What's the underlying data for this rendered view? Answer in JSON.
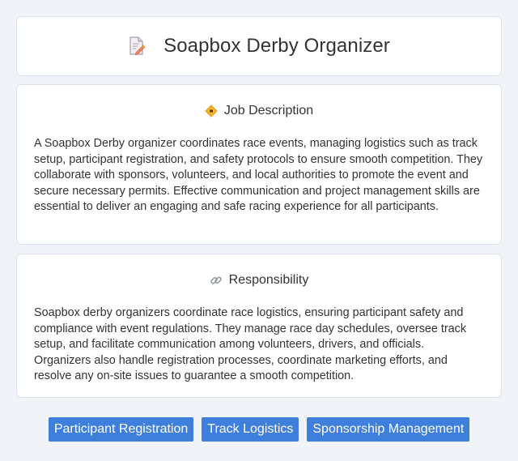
{
  "header": {
    "title": "Soapbox Derby Organizer",
    "icon": "document-edit-icon"
  },
  "job_description": {
    "title": "Job Description",
    "icon": "diamond-sign-icon",
    "text": "A Soapbox Derby organizer coordinates race events, managing logistics such as track setup, participant registration, and safety protocols to ensure smooth competition. They collaborate with sponsors, volunteers, and local authorities to promote the event and secure necessary permits. Effective communication and project management skills are essential to deliver an engaging and safe racing experience for all participants."
  },
  "responsibility": {
    "title": "Responsibility",
    "icon": "link-icon",
    "text": "Soapbox derby organizers coordinate race logistics, ensuring participant safety and compliance with event regulations. They manage race day schedules, oversee track setup, and facilitate communication among volunteers, drivers, and officials. Organizers also handle registration processes, coordinate marketing efforts, and resolve any on-site issues to guarantee a smooth competition."
  },
  "tags": [
    "Participant Registration",
    "Track Logistics",
    "Sponsorship Management"
  ],
  "colors": {
    "background": "#f0f4f9",
    "card": "#ffffff",
    "tag": "#3f7fdc",
    "text": "#333333"
  }
}
